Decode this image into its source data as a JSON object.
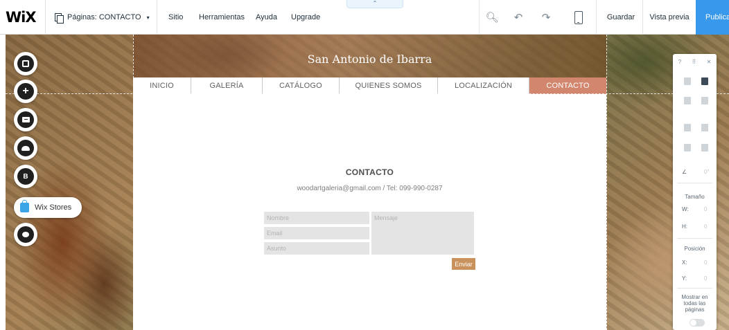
{
  "topbar": {
    "logo": "WiX",
    "pages_label": "Páginas: CONTACTO",
    "pages_caret": "▾",
    "menu": [
      "Sitio",
      "Herramientas",
      "Ayuda",
      "Upgrade"
    ],
    "collapse_glyph": "⌃",
    "tools": {
      "zoom": "🔍︎",
      "undo": "↶",
      "redo": "↷"
    },
    "save": "Guardar",
    "preview": "Vista previa",
    "publish": "Publica"
  },
  "site": {
    "title": "San Antonio de Ibarra",
    "nav": [
      {
        "label": "INICIO",
        "active": false
      },
      {
        "label": "GALERÍA",
        "active": false
      },
      {
        "label": "CATÁLOGO",
        "active": false
      },
      {
        "label": "QUIENES SOMOS",
        "active": false
      },
      {
        "label": "LOCALIZACIÓN",
        "active": false
      },
      {
        "label": "CONTACTO",
        "active": true
      }
    ],
    "contact": {
      "heading": "CONTACTO",
      "line": "woodartgaleria@gmail.com   /   Tel: 099-990-0287",
      "placeholders": {
        "name": "Nombre",
        "email": "Email",
        "subject": "Asunto",
        "message": "Mensaje"
      },
      "send": "Enviar"
    }
  },
  "left_toolbar": {
    "stores_label": "Wix Stores",
    "blog_glyph": "B"
  },
  "right_panel": {
    "help": "?",
    "drag": "⠿",
    "close": "✕",
    "rotation": "0°",
    "size_label": "Tamaño",
    "w_label": "W:",
    "w_value": "0",
    "h_label": "H:",
    "h_value": "0",
    "position_label": "Posición",
    "x_label": "X:",
    "x_value": "0",
    "y_label": "Y:",
    "y_value": "0",
    "show_all": "Mostrar en todas las páginas",
    "angle_glyph": "∠"
  },
  "colors": {
    "publish_blue": "#3899ec",
    "nav_active": "#d2866e",
    "send_button": "#c9915c"
  }
}
